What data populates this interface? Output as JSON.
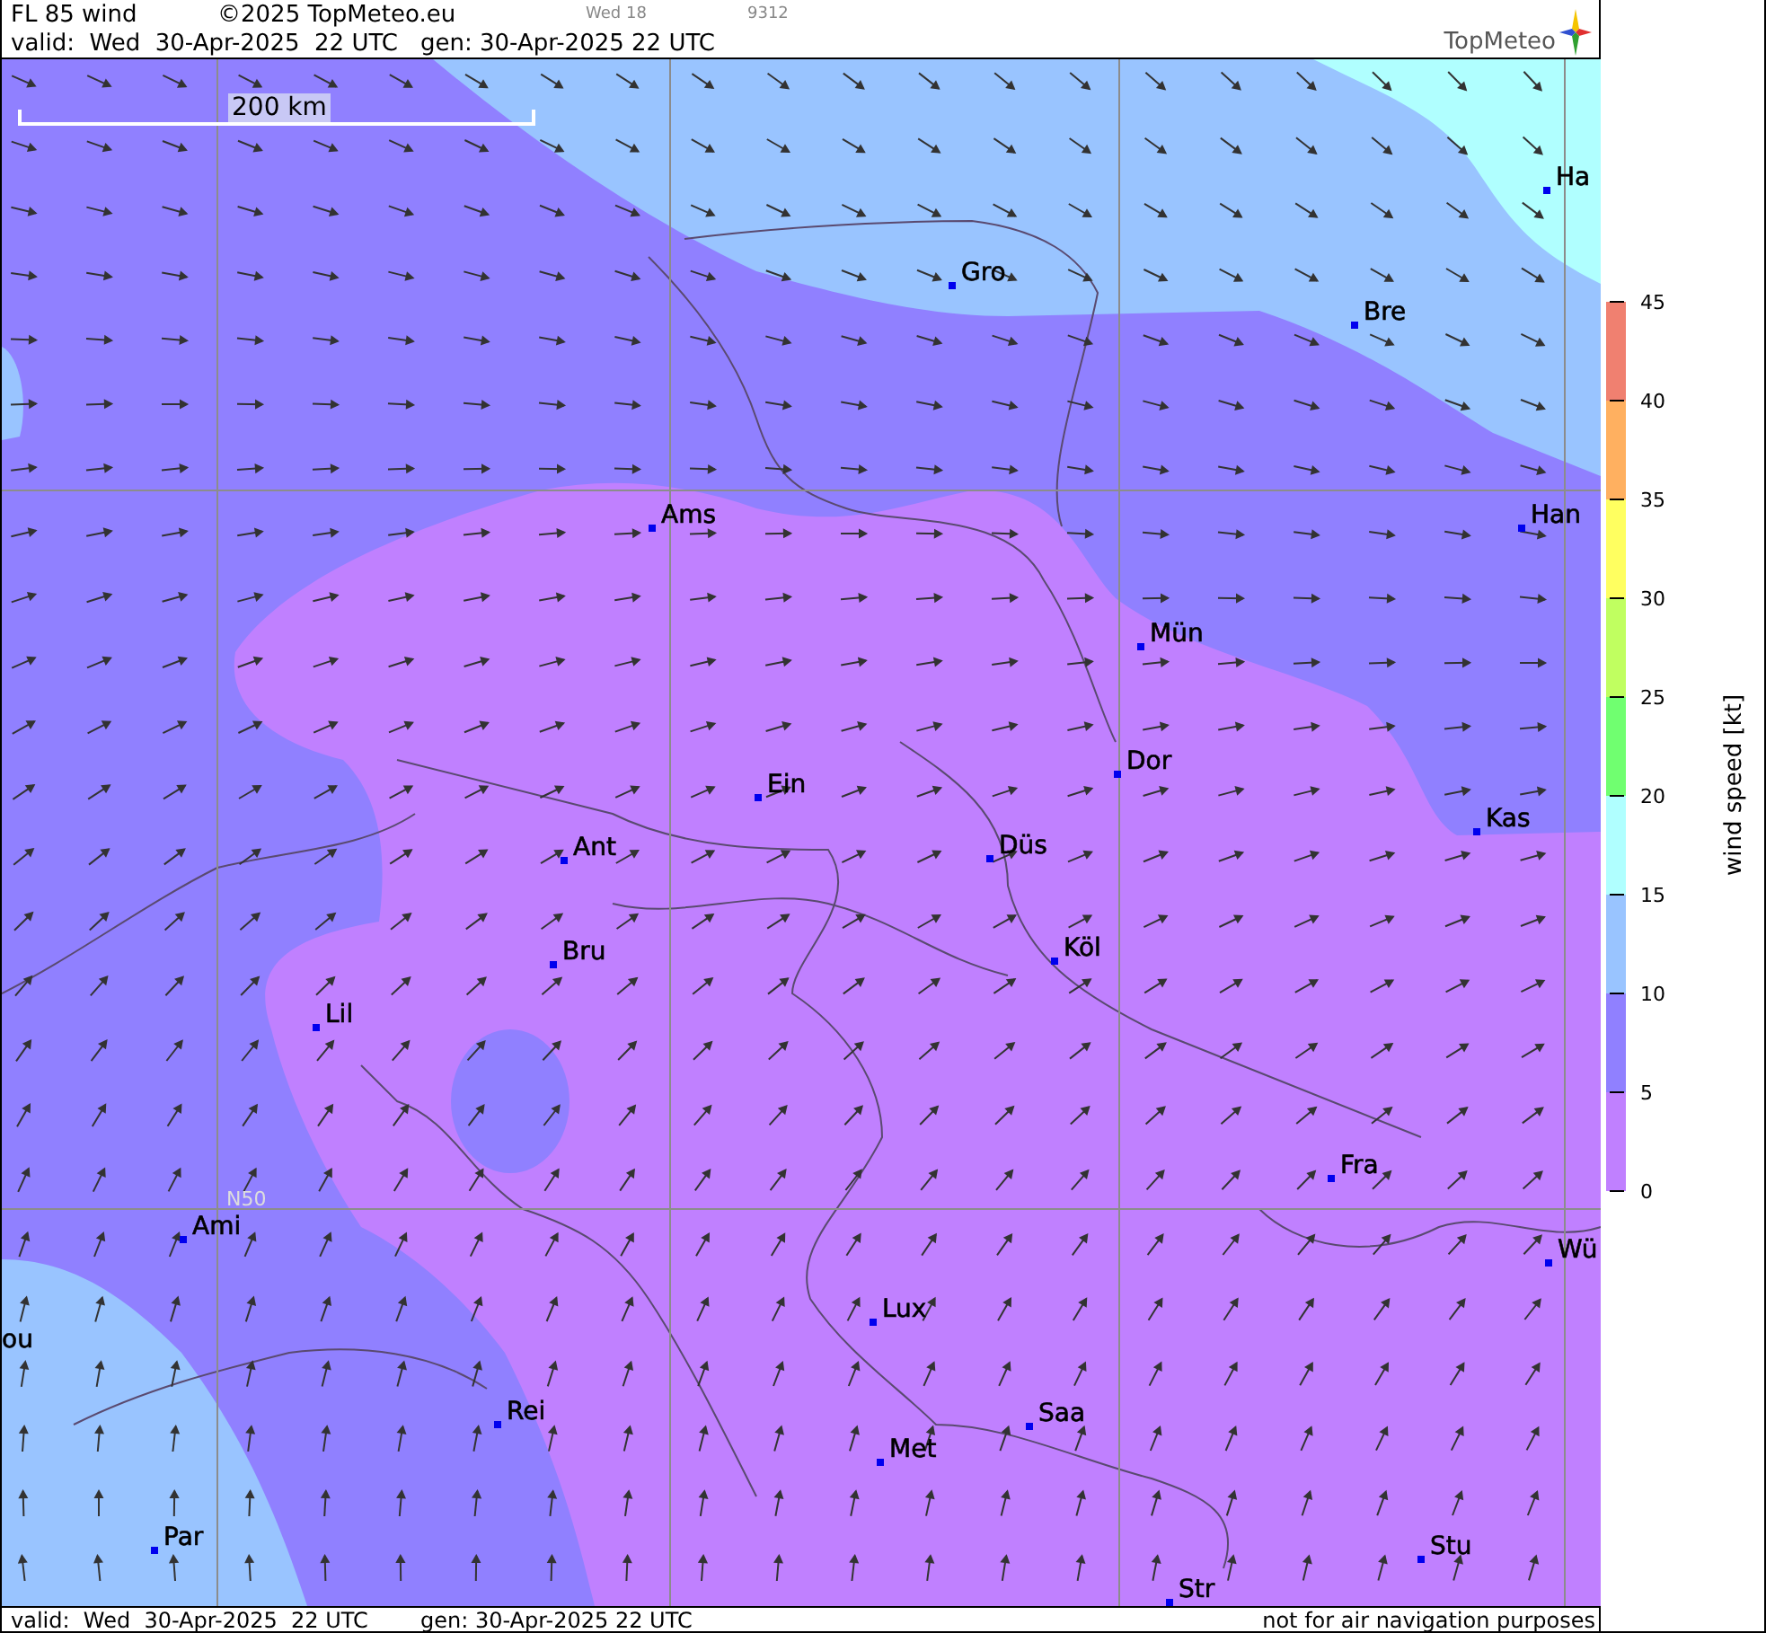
{
  "header": {
    "title": "FL 85 wind",
    "copyright": "©2025 TopMeteo.eu",
    "day_label": "Wed 18",
    "code": "9312",
    "valid": "valid:  Wed  30-Apr-2025  22 UTC",
    "generated": "gen: 30-Apr-2025 22 UTC",
    "logo": "TopMeteo"
  },
  "map": {
    "scale_label": "200 km",
    "grid_label": "N50",
    "cities": [
      {
        "name": "Gro"
      },
      {
        "name": "Bre"
      },
      {
        "name": "Ha"
      },
      {
        "name": "Ams"
      },
      {
        "name": "Han"
      },
      {
        "name": "Mün"
      },
      {
        "name": "Dor"
      },
      {
        "name": "Ein"
      },
      {
        "name": "Düs"
      },
      {
        "name": "Kas"
      },
      {
        "name": "Ant"
      },
      {
        "name": "Köl"
      },
      {
        "name": "Bru"
      },
      {
        "name": "Lil"
      },
      {
        "name": "Fra"
      },
      {
        "name": "Ami"
      },
      {
        "name": "Wü"
      },
      {
        "name": "Lux"
      },
      {
        "name": "ou"
      },
      {
        "name": "Rei"
      },
      {
        "name": "Saa"
      },
      {
        "name": "Met"
      },
      {
        "name": "Par"
      },
      {
        "name": "Stu"
      },
      {
        "name": "Str"
      }
    ]
  },
  "legend": {
    "title": "wind speed [kt]",
    "ticks": [
      "45",
      "40",
      "35",
      "30",
      "25",
      "20",
      "15",
      "10",
      "5",
      "0"
    ],
    "bands": [
      {
        "color": "#f08070"
      },
      {
        "color": "#ffb060"
      },
      {
        "color": "#ffff60"
      },
      {
        "color": "#c0ff60"
      },
      {
        "color": "#70ff70"
      },
      {
        "color": "#b0ffff"
      },
      {
        "color": "#99c4ff"
      },
      {
        "color": "#9080ff"
      },
      {
        "color": "#c080ff"
      }
    ]
  },
  "footer": {
    "valid": "valid:  Wed  30-Apr-2025  22 UTC",
    "generated": "gen: 30-Apr-2025 22 UTC",
    "disclaimer": "not for air navigation purposes"
  }
}
